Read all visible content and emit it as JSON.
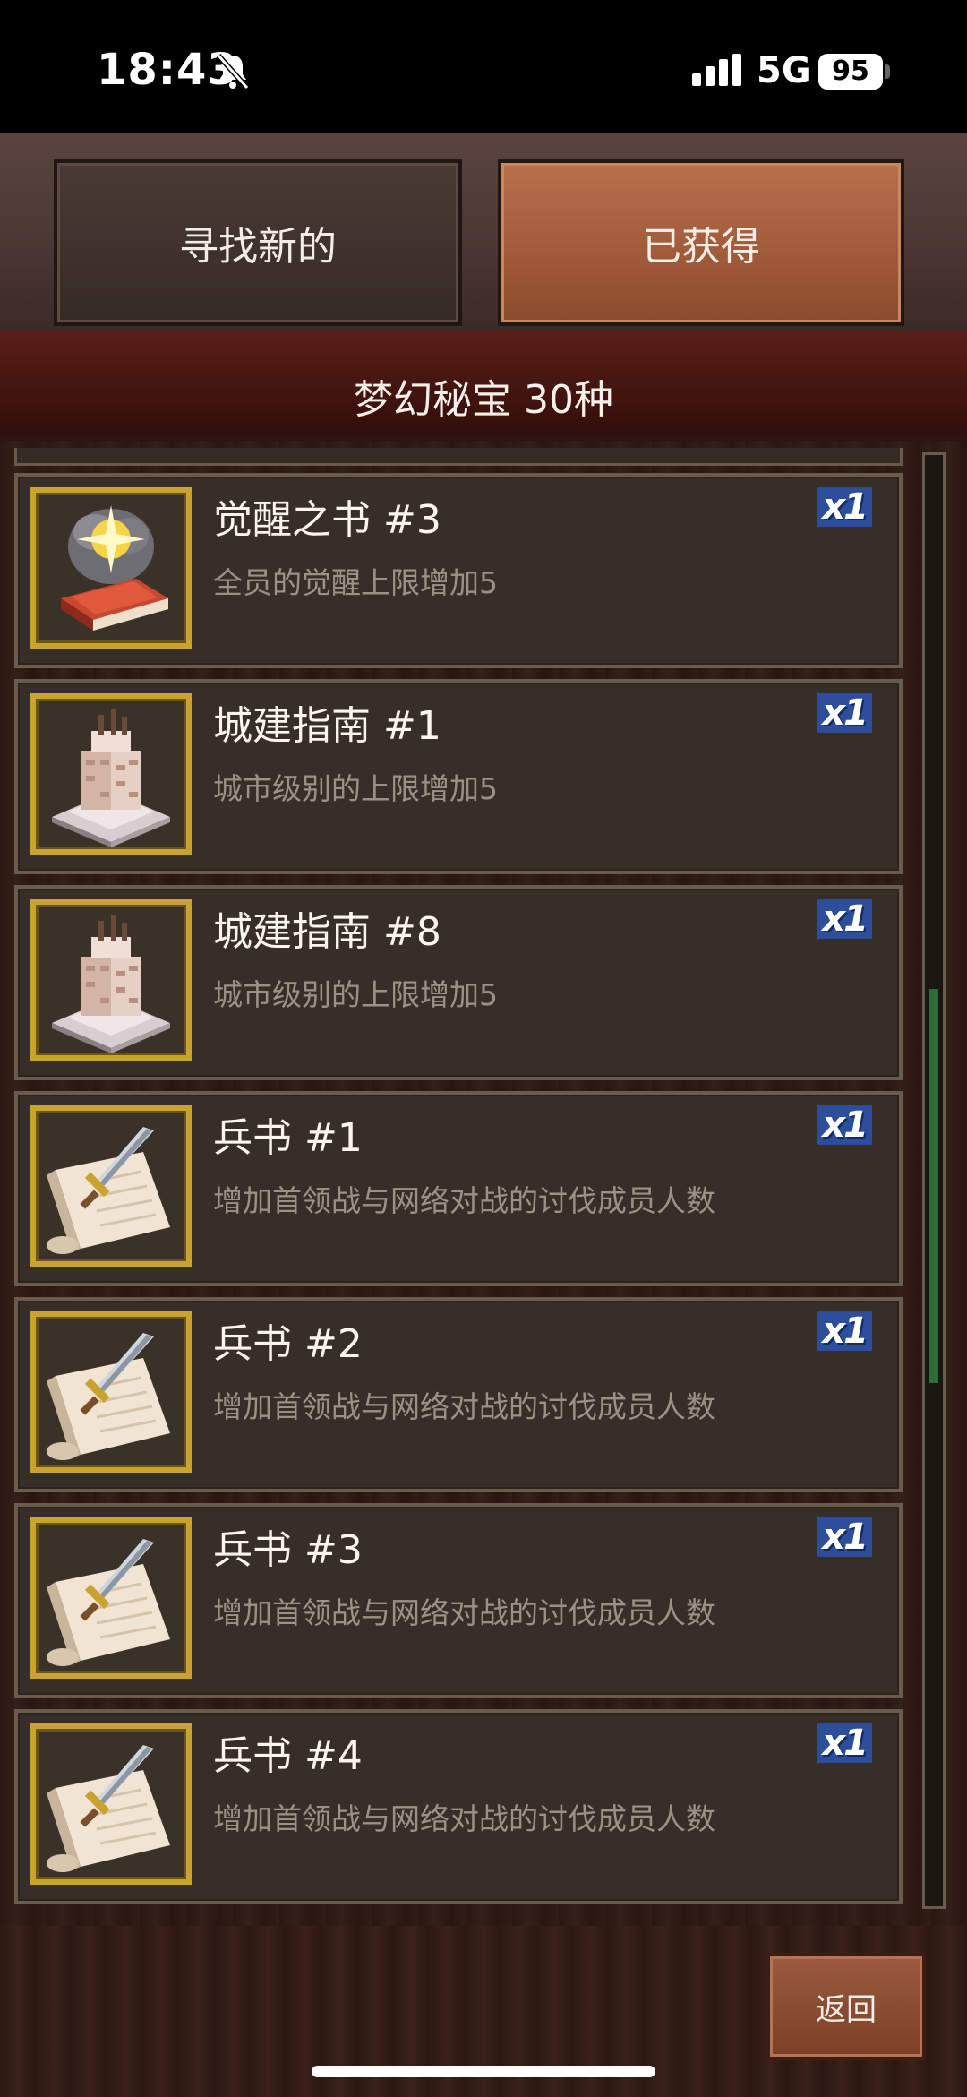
{
  "status": {
    "time": "18:43",
    "network": "5G",
    "battery": "95"
  },
  "tabs": [
    {
      "label": "寻找新的",
      "active": false
    },
    {
      "label": "已获得",
      "active": true
    }
  ],
  "header": {
    "title": "梦幻秘宝 30种"
  },
  "items": [
    {
      "title": "觉醒之书 #3",
      "desc": "全员的觉醒上限增加5",
      "qty": "x1",
      "icon": "awakening-book-icon"
    },
    {
      "title": "城建指南 #1",
      "desc": "城市级别的上限增加5",
      "qty": "x1",
      "icon": "cake-tower-icon"
    },
    {
      "title": "城建指南 #8",
      "desc": "城市级别的上限增加5",
      "qty": "x1",
      "icon": "cake-tower-icon"
    },
    {
      "title": "兵书 #1",
      "desc": "增加首领战与网络对战的讨伐成员人数",
      "qty": "x1",
      "icon": "scroll-sword-icon"
    },
    {
      "title": "兵书 #2",
      "desc": "增加首领战与网络对战的讨伐成员人数",
      "qty": "x1",
      "icon": "scroll-sword-icon"
    },
    {
      "title": "兵书 #3",
      "desc": "增加首领战与网络对战的讨伐成员人数",
      "qty": "x1",
      "icon": "scroll-sword-icon"
    },
    {
      "title": "兵书 #4",
      "desc": "增加首领战与网络对战的讨伐成员人数",
      "qty": "x1",
      "icon": "scroll-sword-icon"
    }
  ],
  "footer": {
    "back_label": "返回"
  },
  "colors": {
    "active_tab": "#a25d3c",
    "frame_gold": "#c9a32e",
    "qty_badge": "#2c4e9c",
    "scroll_thumb": "#2f6b3b"
  }
}
